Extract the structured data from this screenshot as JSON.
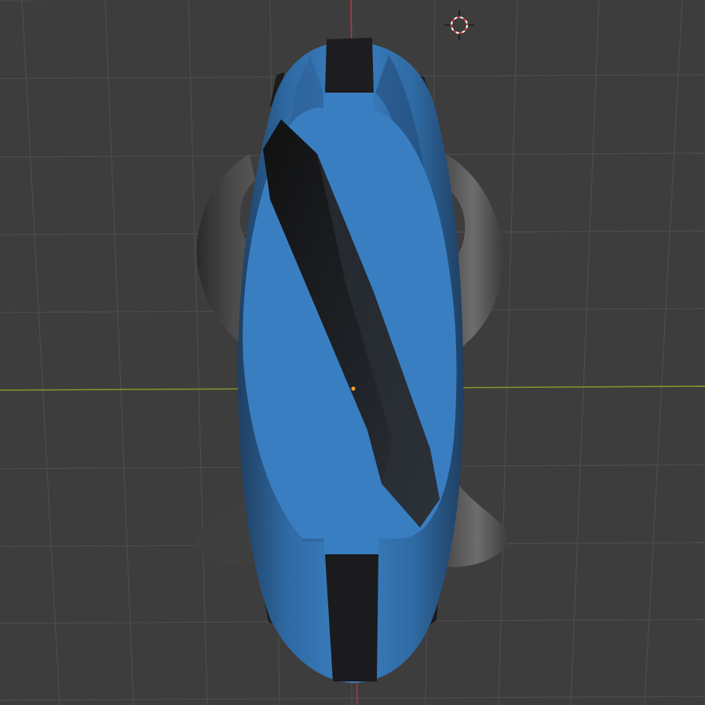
{
  "viewport": {
    "label": "",
    "colors": {
      "background": "#3d3d3d",
      "grid": "#4c4c4c",
      "x_axis": "#7e9a2c",
      "y_axis": "#a83a45",
      "body_blue": "#3a7fc3",
      "body_blue_dark": "#2b5d92",
      "tire": "#1d1d1f",
      "handle": "#4a4a4a",
      "origin": "#f0a030"
    },
    "objects": [
      {
        "name": "3d-cursor-icon",
        "kind": "3D cursor"
      },
      {
        "name": "scene-origin",
        "kind": "object origin"
      },
      {
        "name": "unicycle-mesh",
        "kind": "mesh object"
      }
    ]
  }
}
